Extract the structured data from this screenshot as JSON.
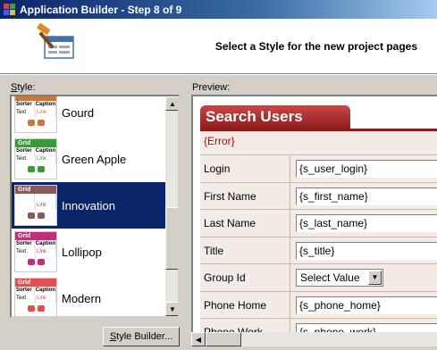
{
  "window": {
    "title": "Application Builder - Step 8 of 9"
  },
  "header": {
    "instruction": "Select a Style for the new project pages",
    "icon": "builder-tools-icon"
  },
  "style_list": {
    "label_prefix": "S",
    "label_rest": "tyle:",
    "items": [
      {
        "name": "Gourd",
        "thumb_title": "",
        "color": "#c9773d",
        "selected": false
      },
      {
        "name": "Green Apple",
        "thumb_title": "Grid",
        "color": "#3a9a3a",
        "selected": false
      },
      {
        "name": "Innovation",
        "thumb_title": "Grid",
        "color": "#8a5a5a",
        "selected": true
      },
      {
        "name": "Lollipop",
        "thumb_title": "Grid",
        "color": "#c0307a",
        "selected": false
      },
      {
        "name": "Modern",
        "thumb_title": "Grid",
        "color": "#e05050",
        "selected": false
      }
    ],
    "thumb_headers": [
      "Sorter",
      "Caption"
    ],
    "thumb_cells": [
      "Text",
      "Link"
    ]
  },
  "style_builder_button": {
    "label_prefix": "S",
    "label_rest": "tyle Builder..."
  },
  "preview": {
    "label": "Preview:",
    "form_title": "Search Users",
    "error": "{Error}",
    "fields": [
      {
        "label": "Login",
        "value": "{s_user_login}",
        "type": "text"
      },
      {
        "label": "First Name",
        "value": "{s_first_name}",
        "type": "text"
      },
      {
        "label": "Last Name",
        "value": "{s_last_name}",
        "type": "text"
      },
      {
        "label": "Title",
        "value": "{s_title}",
        "type": "text"
      },
      {
        "label": "Group Id",
        "value": "Select Value",
        "type": "select"
      },
      {
        "label": "Phone Home",
        "value": "{s_phone_home}",
        "type": "text"
      },
      {
        "label": "Phone Work",
        "value": "{s_phone_work}",
        "type": "text"
      }
    ]
  },
  "colors": {
    "titlebar": "#0a246a",
    "selection": "#0a246a",
    "preview_accent": "#8e1c1c",
    "error": "#c00000"
  }
}
